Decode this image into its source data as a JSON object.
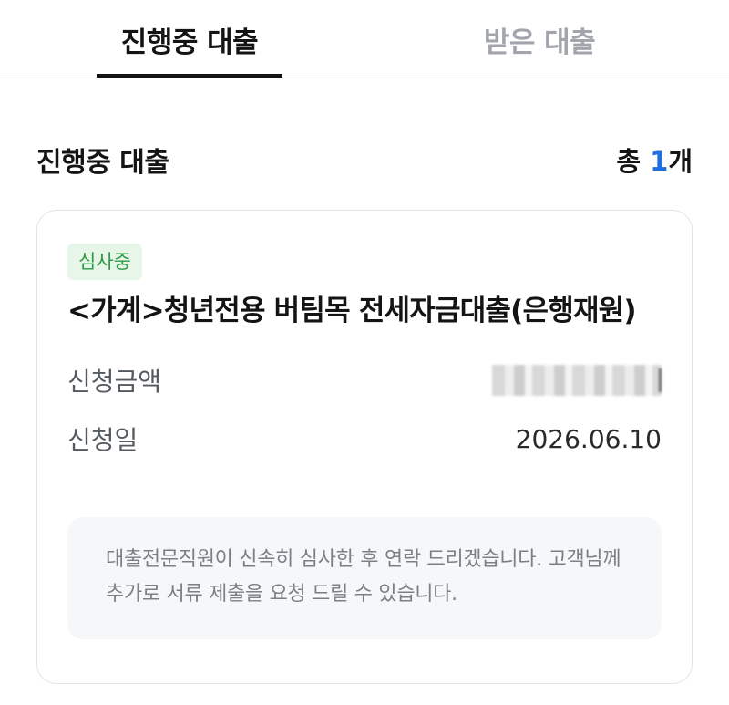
{
  "tabs": [
    {
      "label": "진행중 대출",
      "active": true
    },
    {
      "label": "받은 대출",
      "active": false
    }
  ],
  "section": {
    "title": "진행중 대출",
    "count_prefix": "총 ",
    "count_value": "1",
    "count_suffix": "개"
  },
  "loan": {
    "status_badge": "심사중",
    "title": "<가계>청년전용 버팀목 전세자금대출(은행재원)",
    "amount_label": "신청금액",
    "date_label": "신청일",
    "date_value": "2026.06.10",
    "notice": "대출전문직원이 신속히 심사한 후 연락 드리겠습니다. 고객님께 추가로 서류 제출을 요청 드릴 수 있습니다."
  },
  "colors": {
    "accent_blue": "#1e6fe0",
    "badge_bg": "#e8f6ea",
    "badge_text": "#2e9a45"
  }
}
